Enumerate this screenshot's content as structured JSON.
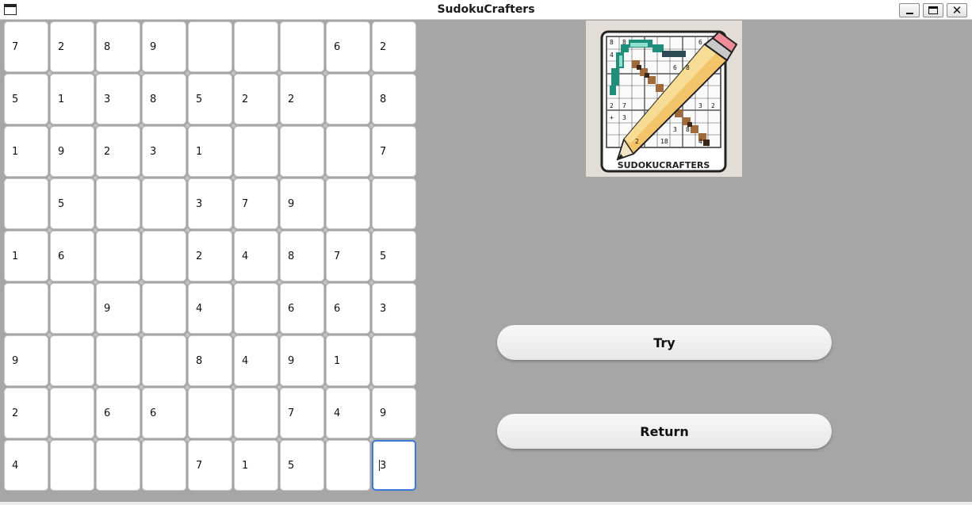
{
  "window": {
    "title": "SudokuCrafters",
    "controls": {
      "minimize": "minimize",
      "maximize": "maximize",
      "close": "✕"
    }
  },
  "grid": {
    "rows": [
      [
        "7",
        "2",
        "8",
        "9",
        "",
        "",
        "",
        "6",
        "2"
      ],
      [
        "5",
        "1",
        "3",
        "8",
        "5",
        "2",
        "2",
        "",
        "8"
      ],
      [
        "1",
        "9",
        "2",
        "3",
        "1",
        "",
        "",
        "",
        "7"
      ],
      [
        "",
        "5",
        "",
        "",
        "3",
        "7",
        "9",
        "",
        ""
      ],
      [
        "1",
        "6",
        "",
        "",
        "2",
        "4",
        "8",
        "7",
        "5"
      ],
      [
        "",
        "",
        "9",
        "",
        "4",
        "",
        "6",
        "6",
        "3"
      ],
      [
        "9",
        "",
        "",
        "",
        "8",
        "4",
        "9",
        "1",
        ""
      ],
      [
        "2",
        "",
        "6",
        "6",
        "",
        "",
        "7",
        "4",
        "9"
      ],
      [
        "4",
        "",
        "",
        "",
        "7",
        "1",
        "5",
        "",
        "3"
      ]
    ],
    "active_cell": {
      "row": 8,
      "col": 8
    }
  },
  "logo": {
    "text": "SUDOKUCRAFTERS"
  },
  "buttons": {
    "try": "Try",
    "return": "Return"
  },
  "colors": {
    "background": "#a6a6a6",
    "active_border": "#3a7bd5"
  }
}
